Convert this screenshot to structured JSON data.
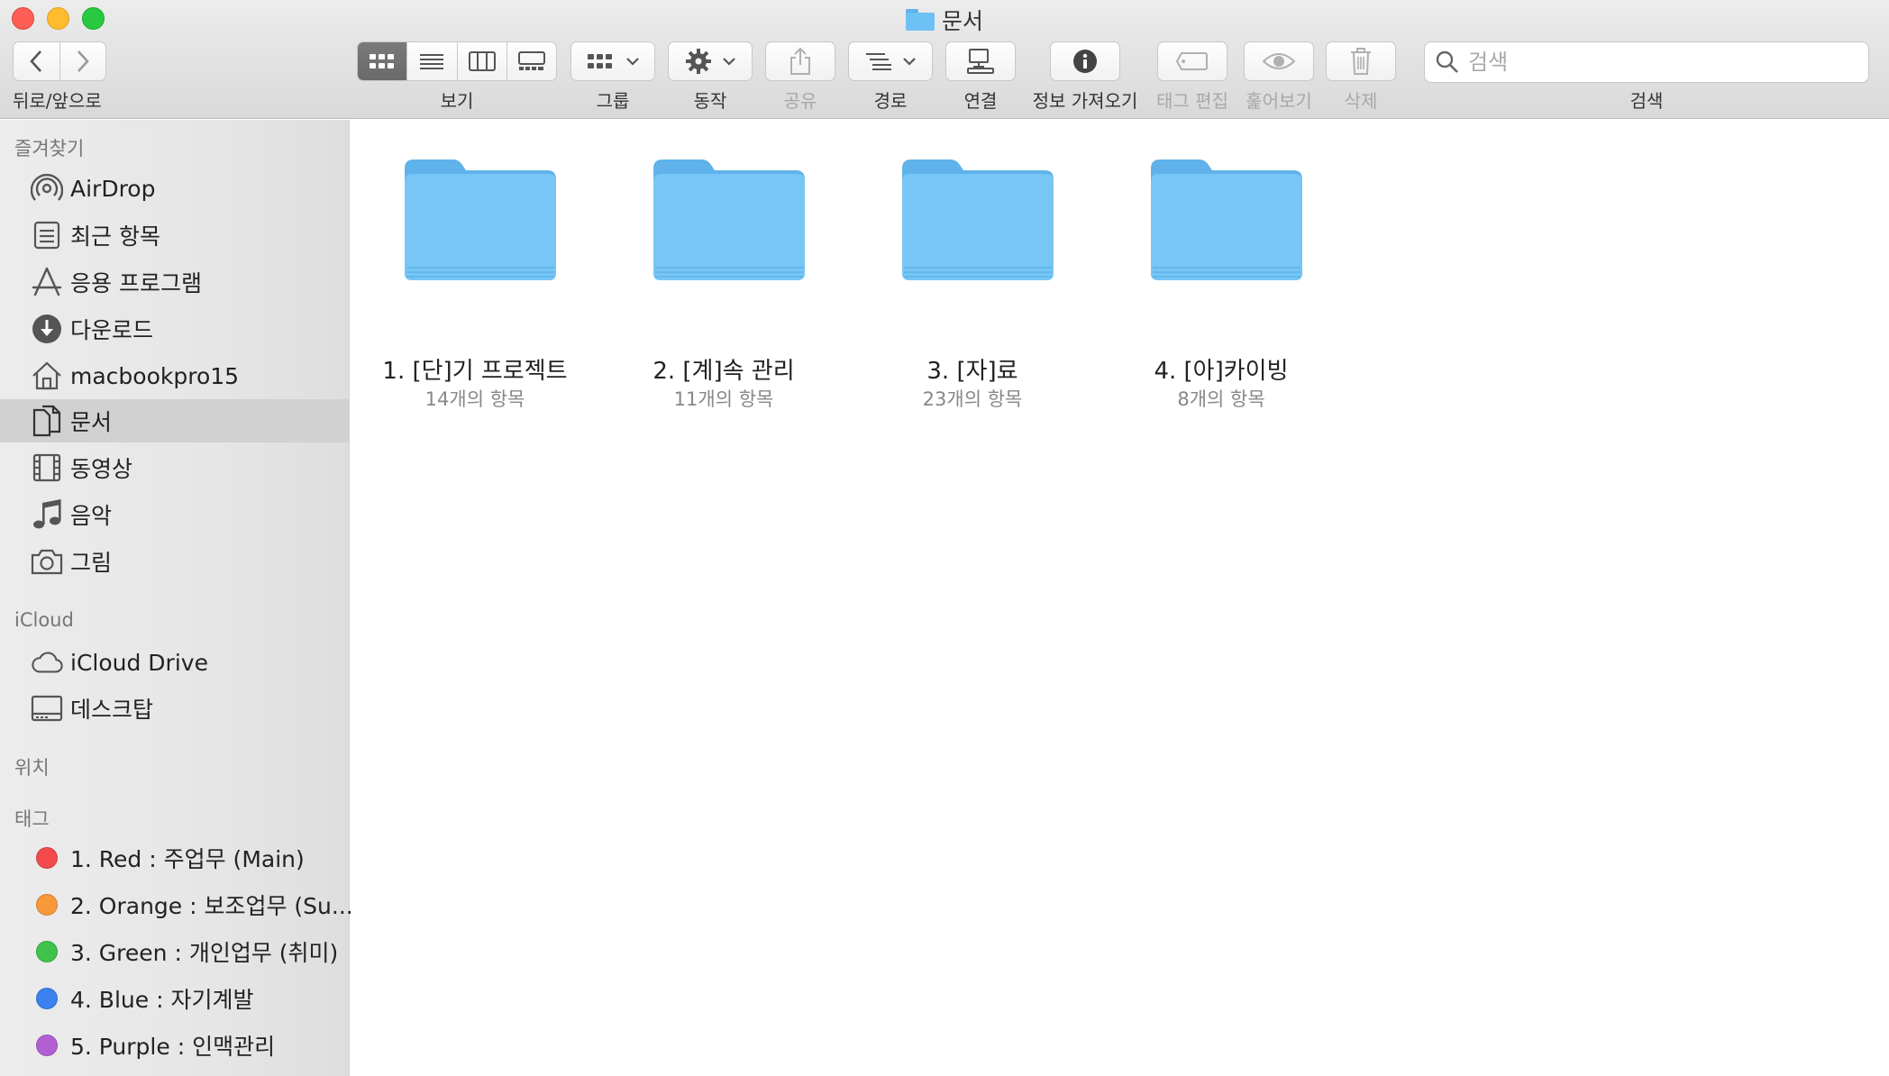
{
  "window": {
    "title": "문서"
  },
  "toolbar": {
    "nav_label": "뒤로/앞으로",
    "view_label": "보기",
    "group_label": "그룹",
    "action_label": "동작",
    "share_label": "공유",
    "path_label": "경로",
    "connect_label": "연결",
    "info_label": "정보 가져오기",
    "tags_label": "태그 편집",
    "quicklook_label": "훑어보기",
    "delete_label": "삭제",
    "search_label": "검색",
    "search_placeholder": "검색"
  },
  "sidebar": {
    "favorites_header": "즐겨찾기",
    "favorites": [
      {
        "label": "AirDrop",
        "icon": "airdrop-icon"
      },
      {
        "label": "최근 항목",
        "icon": "recents-icon"
      },
      {
        "label": "응용 프로그램",
        "icon": "applications-icon"
      },
      {
        "label": "다운로드",
        "icon": "downloads-icon"
      },
      {
        "label": "macbookpro15",
        "icon": "home-icon"
      },
      {
        "label": "문서",
        "icon": "documents-icon",
        "selected": true
      },
      {
        "label": "동영상",
        "icon": "movies-icon"
      },
      {
        "label": "음악",
        "icon": "music-icon"
      },
      {
        "label": "그림",
        "icon": "pictures-icon"
      }
    ],
    "icloud_header": "iCloud",
    "icloud": [
      {
        "label": "iCloud Drive",
        "icon": "cloud-icon"
      },
      {
        "label": "데스크탑",
        "icon": "desktop-icon"
      }
    ],
    "locations_header": "위치",
    "tags_header": "태그",
    "tags": [
      {
        "label": "1. Red : 주업무  (Main)",
        "color": "#f24a4a"
      },
      {
        "label": "2. Orange : 보조업무 (Su...",
        "color": "#f7983a"
      },
      {
        "label": "3. Green : 개인업무  (취미)",
        "color": "#3fc34a"
      },
      {
        "label": "4. Blue : 자기계발",
        "color": "#3b82f0"
      },
      {
        "label": "5. Purple : 인맥관리",
        "color": "#b25fd4"
      }
    ]
  },
  "files": [
    {
      "name": "1. [단]기 프로젝트",
      "count": "14개의 항목"
    },
    {
      "name": "2. [계]속 관리",
      "count": "11개의 항목"
    },
    {
      "name": "3. [자]료",
      "count": "23개의 항목"
    },
    {
      "name": "4. [아]카이빙",
      "count": "8개의 항목"
    }
  ],
  "colors": {
    "folder": "#77c6f5",
    "folder_dark": "#5fb2ea",
    "selection": "#d1d1d1"
  }
}
